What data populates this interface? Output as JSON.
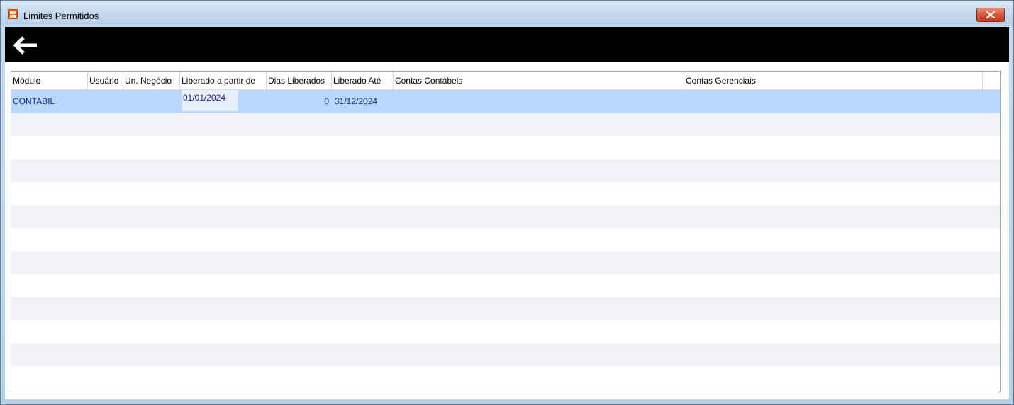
{
  "window": {
    "title": "Limites Permitidos"
  },
  "toolbar": {
    "back_icon": "arrow-left-icon"
  },
  "grid": {
    "columns": [
      "Módulo",
      "Usuário",
      "Un. Negócio",
      "Liberado a partir de",
      "Dias Liberados",
      "Liberado Até",
      "Contas Contábeis",
      "Contas Gerenciais"
    ],
    "rows": [
      {
        "modulo": "CONTABIL",
        "usuario": "",
        "un_negocio": "",
        "liberado_a_partir_de": "01/01/2024",
        "dias_liberados": "0",
        "liberado_ate": "31/12/2024",
        "contas_contabeis": "",
        "contas_gerenciais": ""
      }
    ]
  },
  "colors": {
    "selected_row": "#b7d8f8",
    "alt_row": "#f1f2f6",
    "toolbar": "#000000",
    "cell_text": "#1a1a8c"
  }
}
